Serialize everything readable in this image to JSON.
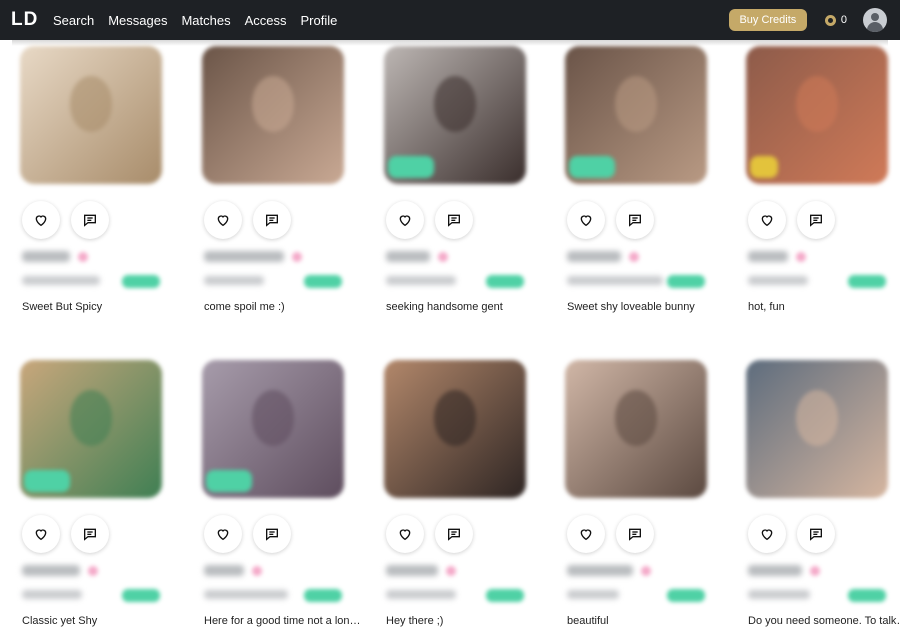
{
  "app": {
    "logo": "LD"
  },
  "nav": [
    "Search",
    "Messages",
    "Matches",
    "Access",
    "Profile"
  ],
  "header": {
    "buy_credits": "Buy Credits",
    "credit_count": "0"
  },
  "profiles": [
    {
      "bio": "Sweet But Spicy",
      "photo_colors": [
        "#e8d9c6",
        "#a88c6a"
      ],
      "tag": "none"
    },
    {
      "bio": "come spoil me :)",
      "photo_colors": [
        "#6b5548",
        "#c9a994"
      ],
      "tag": "none"
    },
    {
      "bio": "seeking handsome gent",
      "photo_colors": [
        "#bdb7b4",
        "#3a2e2c"
      ],
      "tag": "green"
    },
    {
      "bio": "Sweet shy loveable bunny",
      "photo_colors": [
        "#6a5448",
        "#b99a84"
      ],
      "tag": "green"
    },
    {
      "bio": "hot, fun",
      "photo_colors": [
        "#8d5b4a",
        "#d07a58"
      ],
      "tag": "gold"
    },
    {
      "bio": "Classic yet Shy",
      "photo_colors": [
        "#c9a77c",
        "#3f7f53"
      ],
      "tag": "green"
    },
    {
      "bio": "Here for a good time not a long time",
      "photo_colors": [
        "#a79cab",
        "#5e4d5e"
      ],
      "tag": "green"
    },
    {
      "bio": "Hey there ;)",
      "photo_colors": [
        "#b3886b",
        "#2e2523"
      ],
      "tag": "none"
    },
    {
      "bio": "beautiful",
      "photo_colors": [
        "#d1b7a7",
        "#5b4940"
      ],
      "tag": "none"
    },
    {
      "bio": "Do you need someone. To talk to",
      "photo_colors": [
        "#5d6c7d",
        "#d6b6a0"
      ],
      "tag": "none"
    }
  ],
  "colors": {
    "topbar": "#1e2125",
    "accent_gold": "#c5a968",
    "online_green": "#4fd1a5"
  }
}
